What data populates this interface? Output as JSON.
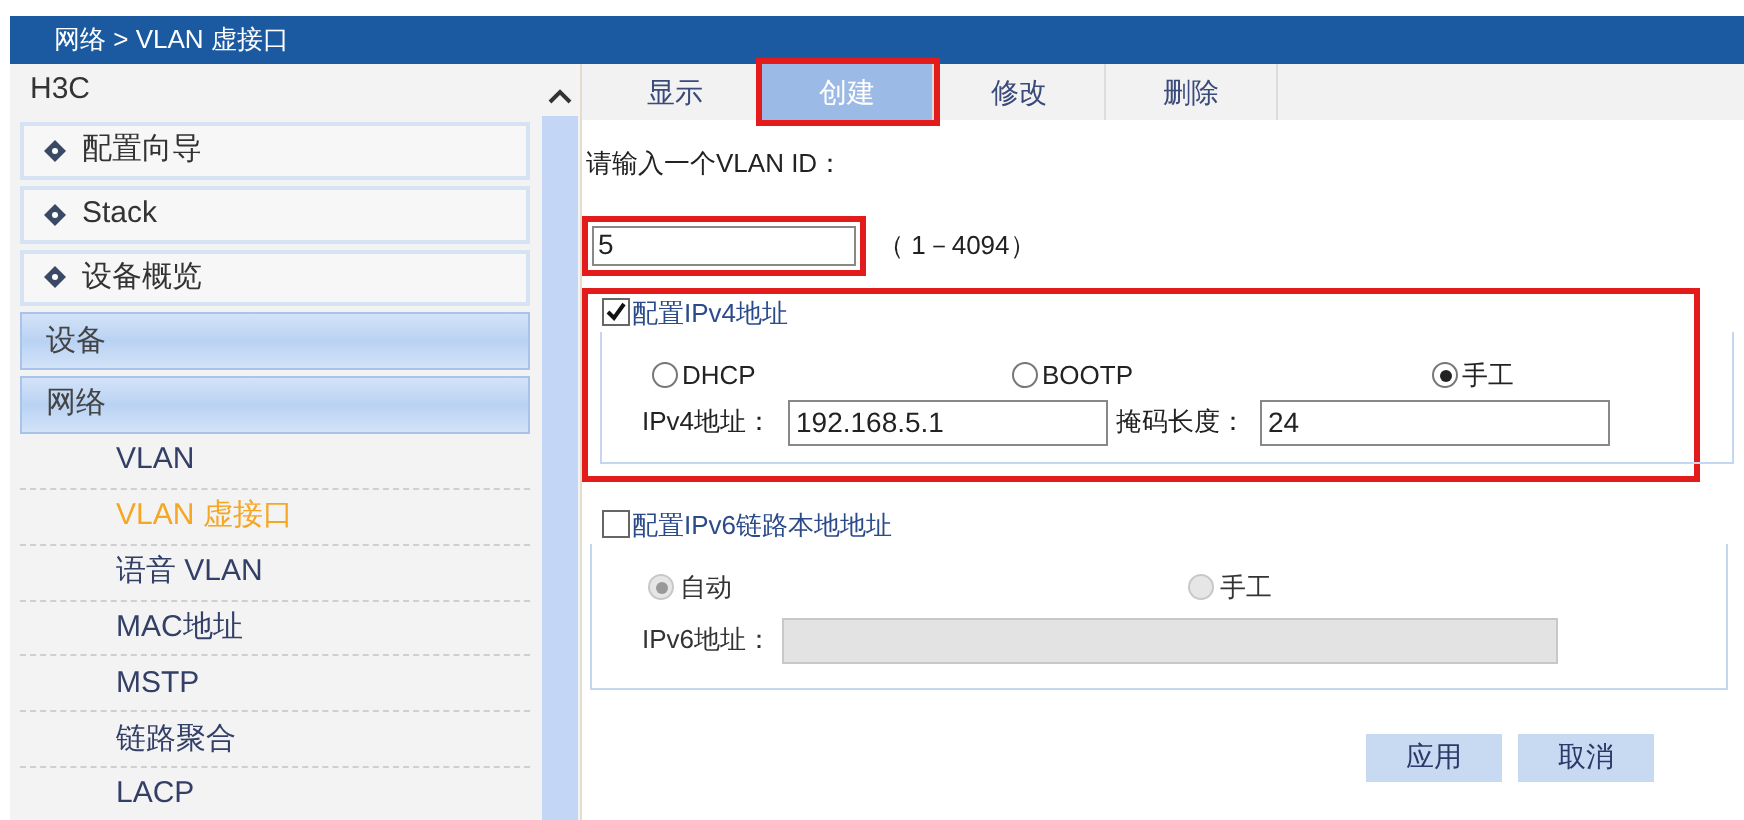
{
  "breadcrumb": "网络 > VLAN 虚接口",
  "sidebar": {
    "brand": "H3C",
    "items": [
      {
        "kind": "section",
        "label": "配置向导",
        "selected": false
      },
      {
        "kind": "section",
        "label": "Stack",
        "selected": false
      },
      {
        "kind": "section",
        "label": "设备概览",
        "selected": false
      },
      {
        "kind": "category",
        "label": "设备",
        "selected": false
      },
      {
        "kind": "category",
        "label": "网络",
        "selected": false
      },
      {
        "kind": "link",
        "label": "VLAN",
        "selected": false
      },
      {
        "kind": "link",
        "label": "VLAN 虚接口",
        "selected": true
      },
      {
        "kind": "link",
        "label": "语音 VLAN",
        "selected": false
      },
      {
        "kind": "link",
        "label": "MAC地址",
        "selected": false
      },
      {
        "kind": "link",
        "label": "MSTP",
        "selected": false
      },
      {
        "kind": "link",
        "label": "链路聚合",
        "selected": false
      },
      {
        "kind": "link",
        "label": "LACP",
        "selected": false
      }
    ]
  },
  "tabs": [
    {
      "label": "显示",
      "selected": false,
      "highlighted": false
    },
    {
      "label": "创建",
      "selected": true,
      "highlighted": true
    },
    {
      "label": "修改",
      "selected": false,
      "highlighted": false
    },
    {
      "label": "删除",
      "selected": false,
      "highlighted": false
    }
  ],
  "vlan_prompt": "请输入一个VLAN ID：",
  "vlan_id": {
    "value": "5",
    "range": "（ 1－4094）",
    "highlighted": true
  },
  "ipv4": {
    "label": "配置IPv4地址",
    "checked": true,
    "highlighted": true,
    "modes": [
      {
        "label": "DHCP",
        "selected": false
      },
      {
        "label": "BOOTP",
        "selected": false
      },
      {
        "label": "手工",
        "selected": true
      }
    ],
    "address_label": "IPv4地址：",
    "address": "192.168.5.1",
    "mask_label": "掩码长度：",
    "mask": "24"
  },
  "ipv6": {
    "label": "配置IPv6链路本地地址",
    "checked": false,
    "modes": [
      {
        "label": "自动",
        "selected": true
      },
      {
        "label": "手工",
        "selected": false
      }
    ],
    "address_label": "IPv6地址："
  },
  "buttons": [
    "应用",
    "取消"
  ]
}
